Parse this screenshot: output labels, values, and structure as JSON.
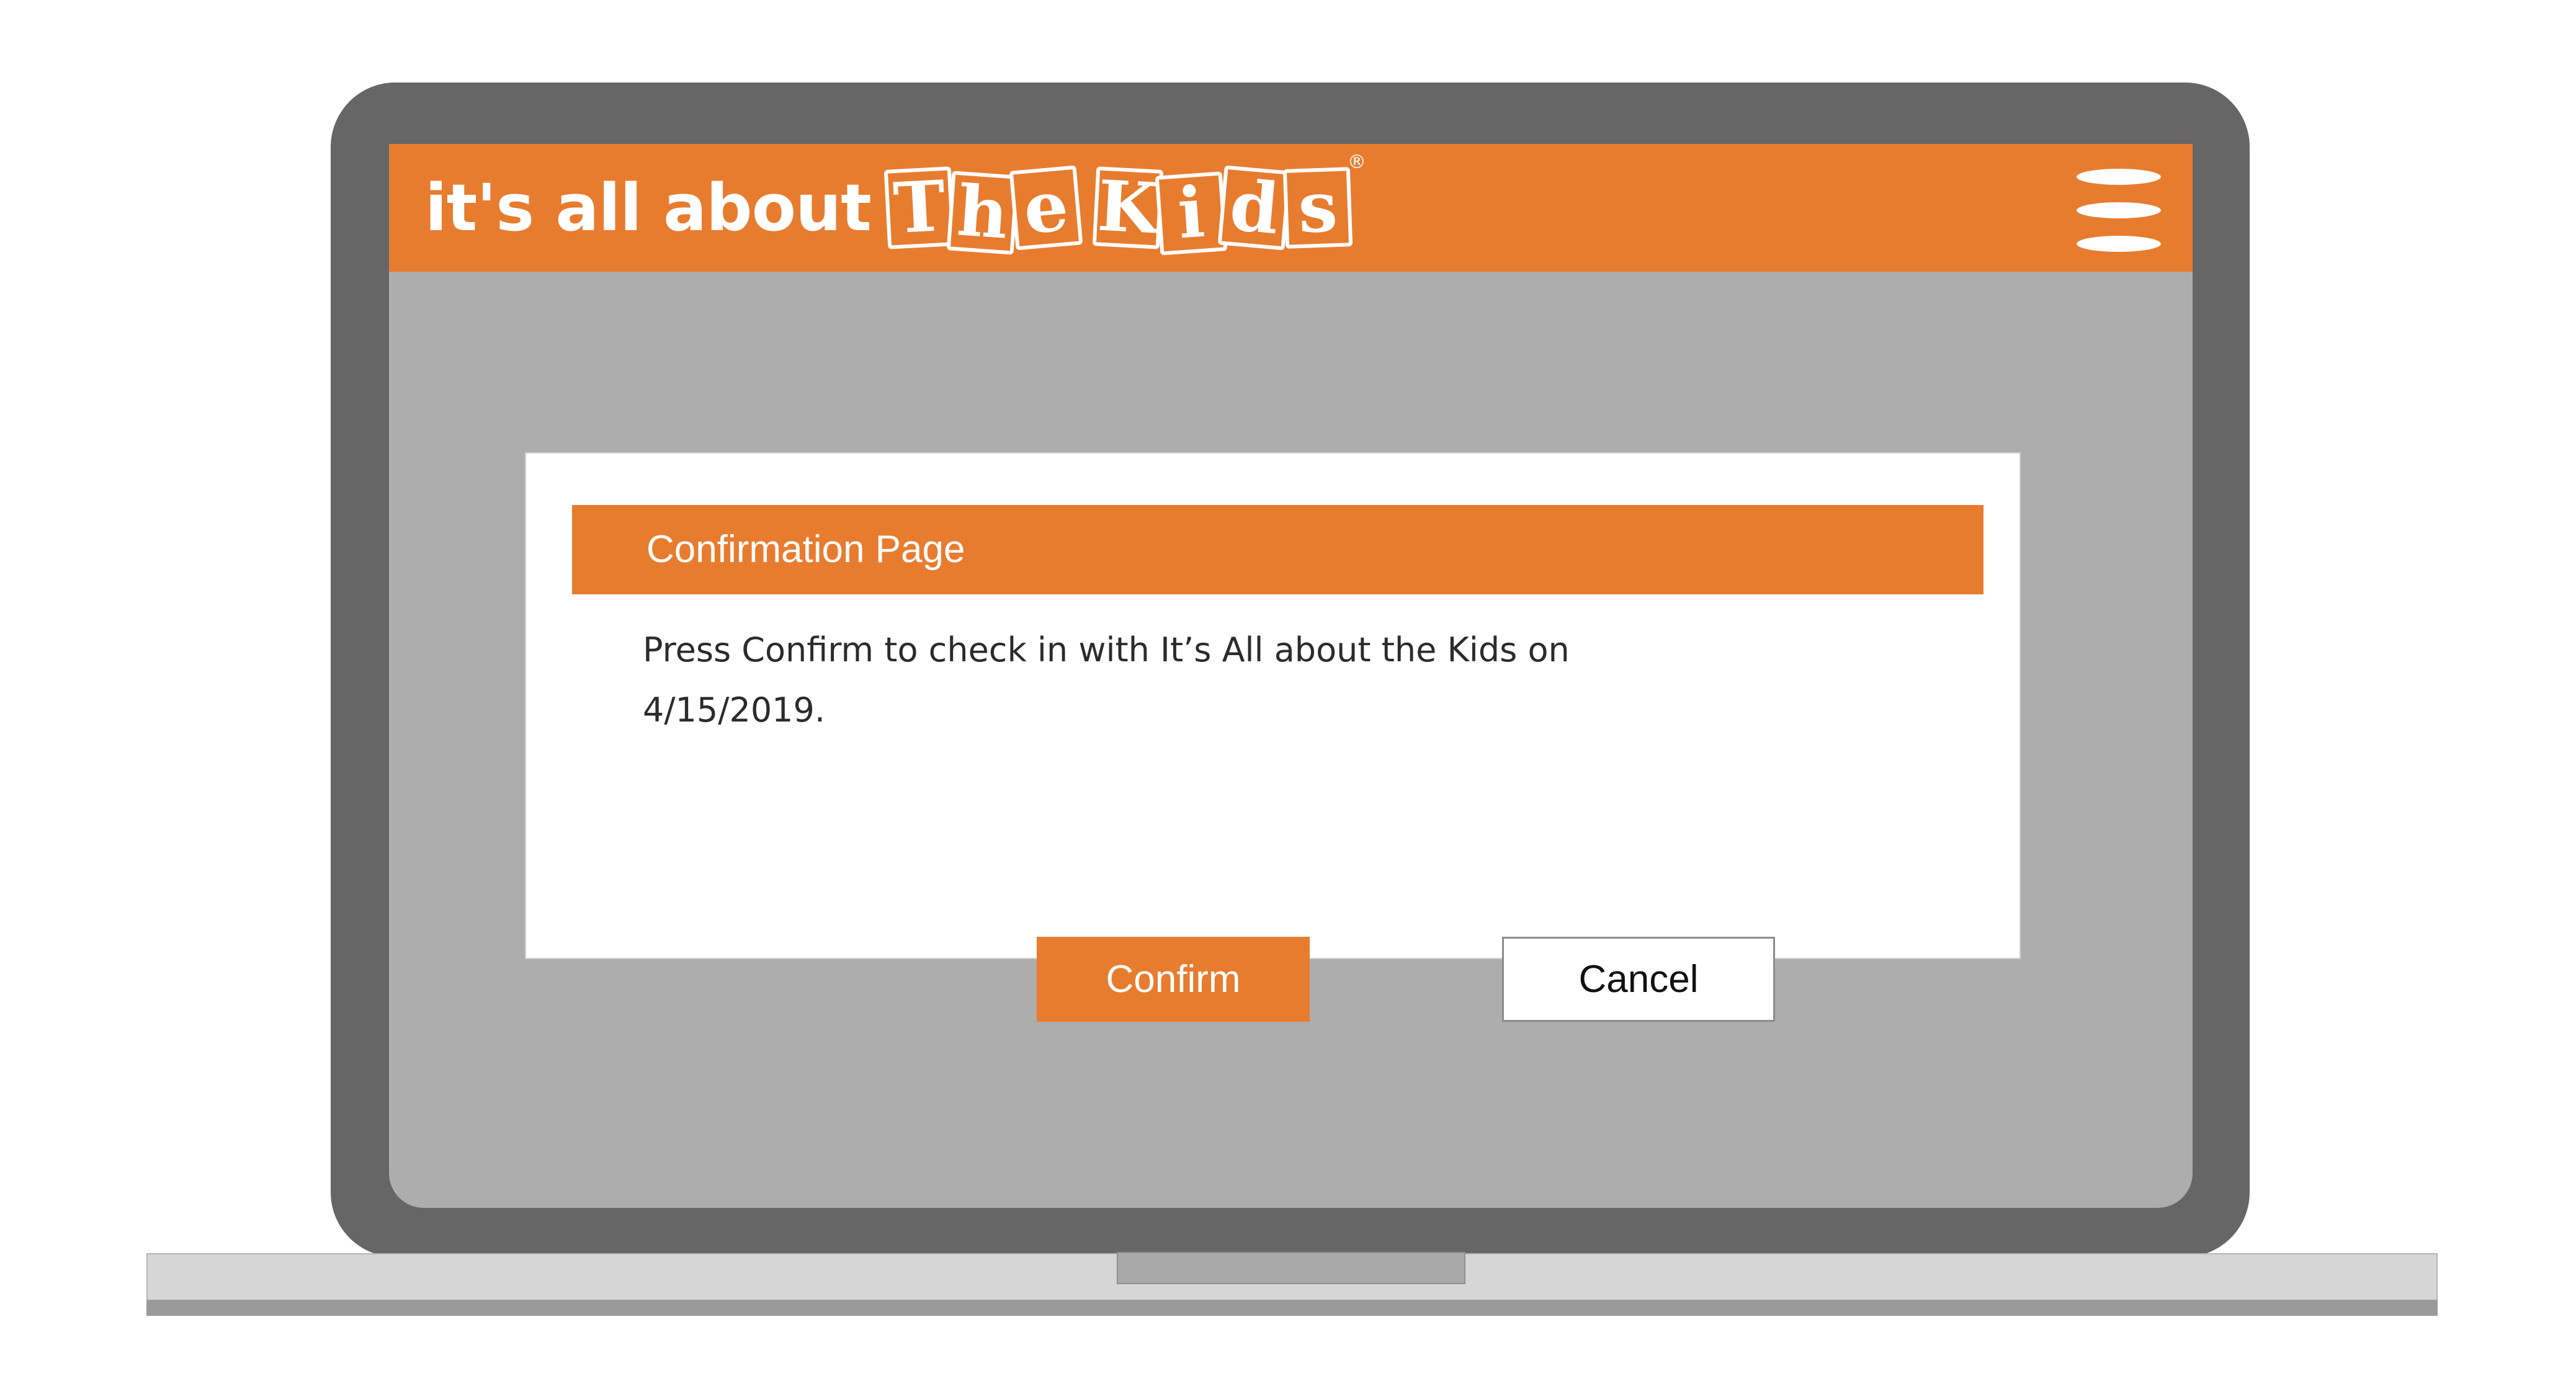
{
  "brand": {
    "prefix": "it's all about",
    "tiles": [
      "T",
      "h",
      "e",
      "K",
      "i",
      "d",
      "s"
    ],
    "registered": "®"
  },
  "header": {
    "menu_icon": "hamburger-menu-icon"
  },
  "dialog": {
    "title": "Confirmation Page",
    "message_line1": "Press Confirm to check in with It’s All about the Kids on",
    "message_line2": "4/15/2019.",
    "confirm_label": "Confirm",
    "cancel_label": "Cancel"
  },
  "colors": {
    "accent": "#e77c2f",
    "screen_background": "#adadad",
    "bezel": "#666666"
  }
}
